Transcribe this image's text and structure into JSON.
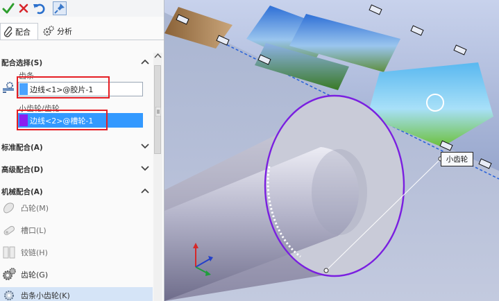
{
  "toolbar": {
    "ok_icon": "checkmark-icon",
    "cancel_icon": "close-icon",
    "undo_icon": "undo-icon",
    "pin_icon": "pushpin-icon"
  },
  "tabs": [
    {
      "label": "配合",
      "icon": "paperclip-icon"
    },
    {
      "label": "分析",
      "icon": "gears-icon"
    }
  ],
  "mate_selection": {
    "title": "配合选择(S)",
    "rack_label": "齿条",
    "rack_value": "边线<1>@胶片-1",
    "gear_label": "小齿轮/齿轮",
    "gear_value": "边线<2>@槽轮-1"
  },
  "sections": {
    "standard": "标准配合(A)",
    "advanced": "高级配合(D)",
    "mechanical": "机械配合(A)"
  },
  "mechanical_items": [
    {
      "label": "凸轮(M)",
      "icon": "cam-icon"
    },
    {
      "label": "槽口(L)",
      "icon": "slot-icon"
    },
    {
      "label": "铰链(H)",
      "icon": "hinge-icon"
    },
    {
      "label": "齿轮(G)",
      "icon": "gear-icon"
    },
    {
      "label": "齿条小齿轮(K)",
      "icon": "rack-pinion-icon"
    }
  ],
  "viewport": {
    "callout_label": "小齿轮"
  },
  "colors": {
    "selection_blue": "#3399ff",
    "highlight_red": "#e51d23",
    "edge_purple": "#7a1fe0",
    "accept_green": "#2e9e2e"
  }
}
